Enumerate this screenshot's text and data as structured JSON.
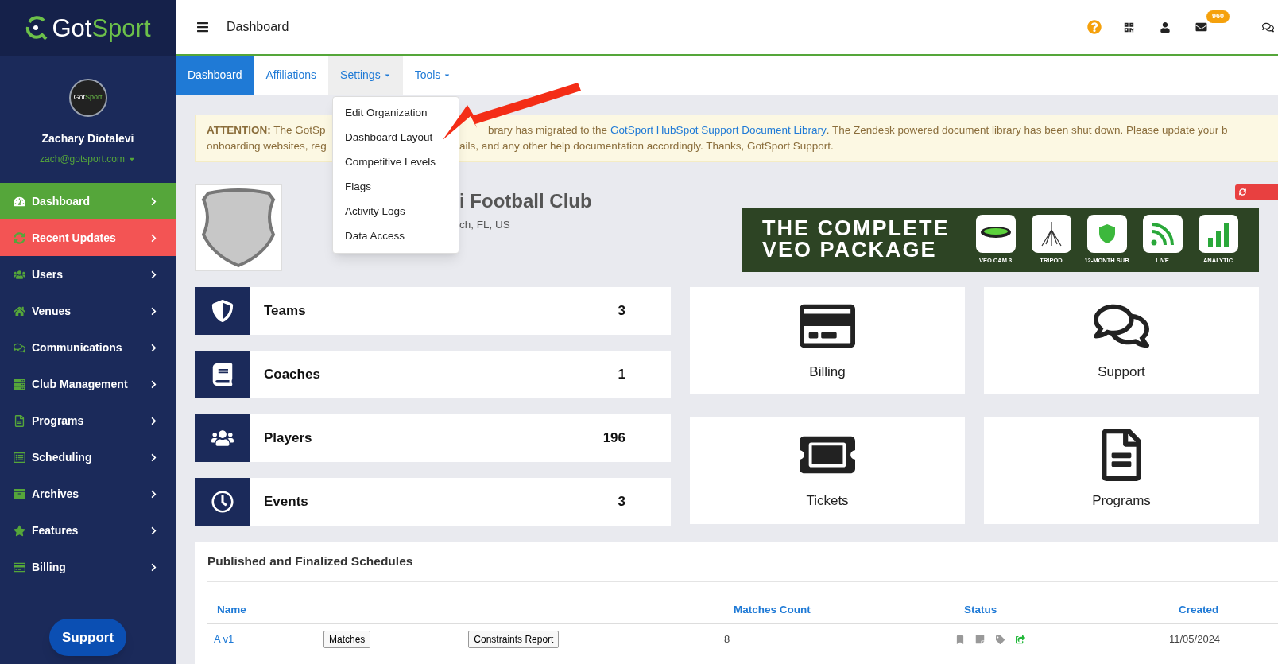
{
  "brand": {
    "logo_left": "Got",
    "logo_right": "Sport",
    "avatar_text_left": "Got",
    "avatar_text_right": "Sport"
  },
  "profile": {
    "name": "Zachary Diotalevi",
    "email": "zach@gotsport.com"
  },
  "sidebar": {
    "items": [
      {
        "label": "Dashboard",
        "highlighted": false,
        "selected": true
      },
      {
        "label": "Recent Updates",
        "highlighted": true,
        "selected": false
      },
      {
        "label": "Users",
        "highlighted": false,
        "selected": false
      },
      {
        "label": "Venues",
        "highlighted": false,
        "selected": false
      },
      {
        "label": "Communications",
        "highlighted": false,
        "selected": false
      },
      {
        "label": "Club Management",
        "highlighted": false,
        "selected": false
      },
      {
        "label": "Programs",
        "highlighted": false,
        "selected": false
      },
      {
        "label": "Scheduling",
        "highlighted": false,
        "selected": false
      },
      {
        "label": "Archives",
        "highlighted": false,
        "selected": false
      },
      {
        "label": "Features",
        "highlighted": false,
        "selected": false
      },
      {
        "label": "Billing",
        "highlighted": false,
        "selected": false
      }
    ],
    "support_button": "Support"
  },
  "header": {
    "title": "Dashboard",
    "mail_badge": "960"
  },
  "tabs": [
    {
      "label": "Dashboard",
      "selected": true,
      "dropdown": false,
      "open": false
    },
    {
      "label": "Affiliations",
      "selected": false,
      "dropdown": false,
      "open": false
    },
    {
      "label": "Settings",
      "selected": false,
      "dropdown": true,
      "open": true
    },
    {
      "label": "Tools",
      "selected": false,
      "dropdown": true,
      "open": false
    }
  ],
  "settings_menu": [
    "Edit Organization",
    "Dashboard Layout",
    "Competitive Levels",
    "Flags",
    "Activity Logs",
    "Data Access"
  ],
  "notice": {
    "line1_start": "**ATTENTION:** The GotSp",
    "line1_middle": "brary has migrated to the",
    "link": "GotSport HubSpot Support Document Library",
    "line1_end": ". The Zendesk powered document library has been shut down. Please update your b",
    "line2_start": "onboarding websites, reg",
    "line2_end": "ails, and any other help documentation accordingly. Thanks, GotSport Support."
  },
  "club": {
    "name": "i Football Club",
    "location": "ch, FL, US"
  },
  "promo": {
    "title_1": "THE COMPLETE",
    "title_2": "VEO PACKAGE",
    "items": [
      "VEO CAM 3",
      "TRIPOD",
      "12-MONTH SUB",
      "LIVE",
      "ANALYTIC"
    ]
  },
  "stats": [
    {
      "label": "Teams",
      "value": "3"
    },
    {
      "label": "Coaches",
      "value": "1"
    },
    {
      "label": "Players",
      "value": "196"
    },
    {
      "label": "Events",
      "value": "3"
    }
  ],
  "tiles": [
    "Billing",
    "Support",
    "Tickets",
    "Programs"
  ],
  "schedules": {
    "title": "Published and Finalized Schedules",
    "columns": [
      "Name",
      "Matches Count",
      "Status",
      "Created"
    ],
    "rows": [
      {
        "name": "A v1",
        "matches_button": "Matches",
        "report_button": "Constraints Report",
        "count": "8",
        "published": true,
        "created": "11/05/2024"
      }
    ]
  }
}
